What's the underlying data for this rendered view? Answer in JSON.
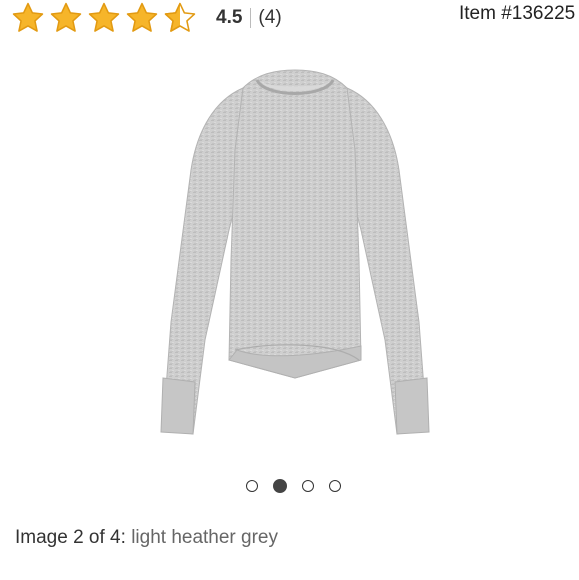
{
  "rating": {
    "stars": 4.5,
    "max_stars": 5,
    "value_text": "4.5",
    "count_text": "(4)",
    "star_color": "#f2a71b"
  },
  "item": {
    "number_text": "Item #136225"
  },
  "product_image": {
    "description_icon": "long-sleeve-sweatshirt-image",
    "color": "#c9c9c9"
  },
  "carousel": {
    "total": 4,
    "active_index": 1
  },
  "caption": {
    "prefix": "Image 2 of 4: ",
    "color_name": "light heather grey"
  }
}
